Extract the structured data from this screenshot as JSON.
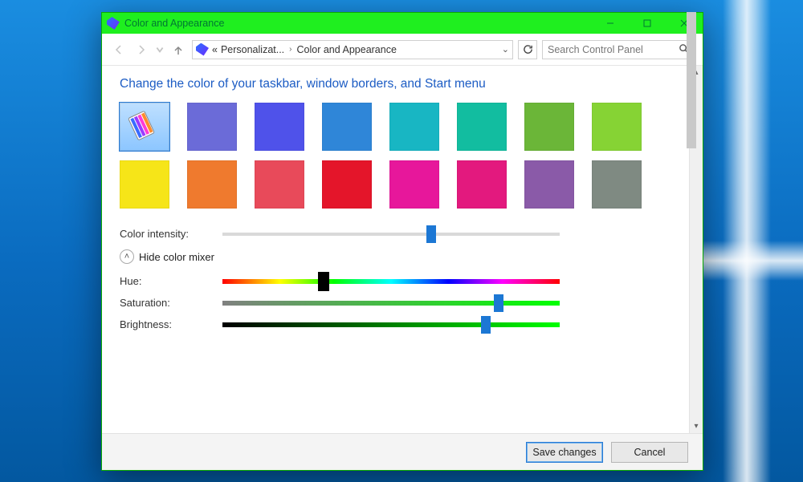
{
  "titlebar": {
    "title": "Color and Appearance",
    "icon": "personalization-icon"
  },
  "navbar": {
    "breadcrumbs": [
      "Personalizat...",
      "Color and Appearance"
    ],
    "search_placeholder": "Search Control Panel"
  },
  "page": {
    "heading": "Change the color of your taskbar, window borders, and Start menu"
  },
  "swatches": {
    "row1": [
      {
        "name": "automatic",
        "auto": true
      },
      {
        "name": "indigo",
        "hex": "#6b6bd8"
      },
      {
        "name": "violetblue",
        "hex": "#4f52ea"
      },
      {
        "name": "blue",
        "hex": "#2f86d8"
      },
      {
        "name": "teal",
        "hex": "#18b6c3"
      },
      {
        "name": "sea",
        "hex": "#12bda0"
      },
      {
        "name": "olive",
        "hex": "#6bb638"
      },
      {
        "name": "lime",
        "hex": "#86d334"
      }
    ],
    "row2": [
      {
        "name": "yellow",
        "hex": "#f6e518"
      },
      {
        "name": "orange",
        "hex": "#ef7a2e"
      },
      {
        "name": "coral",
        "hex": "#e84a5a"
      },
      {
        "name": "red",
        "hex": "#e4152a"
      },
      {
        "name": "magenta",
        "hex": "#e7179b"
      },
      {
        "name": "pink",
        "hex": "#e3197e"
      },
      {
        "name": "purple",
        "hex": "#8a5aa8"
      },
      {
        "name": "gray",
        "hex": "#7f8a82"
      }
    ],
    "selected": "automatic"
  },
  "sliders": {
    "intensity": {
      "label": "Color intensity:",
      "value": 62
    },
    "mixer_toggle_label": "Hide color mixer",
    "hue": {
      "label": "Hue:",
      "value": 30
    },
    "saturation": {
      "label": "Saturation:",
      "value": 82
    },
    "brightness": {
      "label": "Brightness:",
      "value": 78
    }
  },
  "footer": {
    "save_label": "Save changes",
    "cancel_label": "Cancel"
  }
}
